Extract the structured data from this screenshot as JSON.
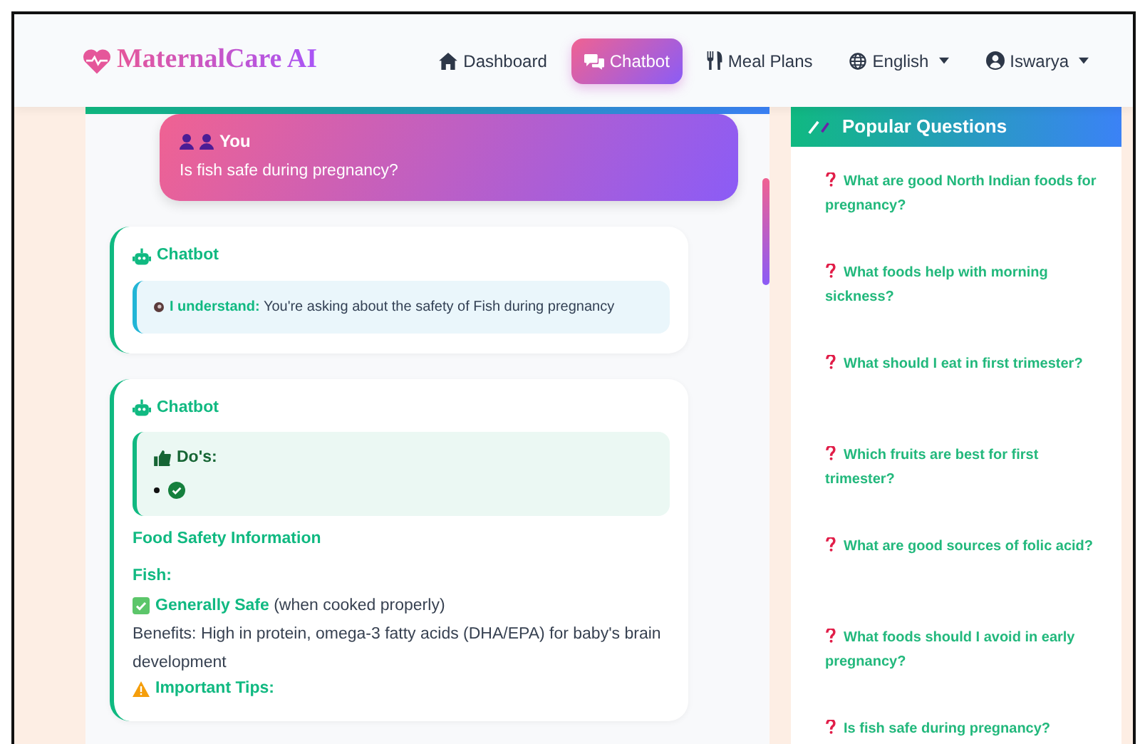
{
  "brand": {
    "name": "MaternalCare AI"
  },
  "nav": [
    {
      "label": "Dashboard",
      "dropdown": false,
      "selected": false
    },
    {
      "label": "Chatbot",
      "dropdown": false,
      "selected": true
    },
    {
      "label": "Meal Plans",
      "dropdown": false,
      "selected": false
    },
    {
      "label": "English",
      "dropdown": true,
      "selected": false
    },
    {
      "label": "Iswarya",
      "dropdown": true,
      "selected": false
    }
  ],
  "messages": [
    {
      "kind": "user",
      "sender": "You",
      "text": "Is fish safe during pregnancy?"
    },
    {
      "kind": "bot",
      "sender": "Chatbot",
      "blocks": [
        {
          "kind": "understand",
          "lead": "I understand:",
          "text": "You're asking about the safety of Fish during pregnancy"
        }
      ]
    },
    {
      "kind": "bot",
      "sender": "Chatbot",
      "blocks": [
        {
          "kind": "dos",
          "title": "Do's:",
          "items": [
            {
              "kind": "check"
            }
          ]
        },
        {
          "kind": "heading",
          "text": "Food Safety Information"
        },
        {
          "kind": "subheading",
          "text": "Fish:"
        },
        {
          "kind": "verdict",
          "label": "Generally Safe",
          "note": "(when cooked properly)"
        },
        {
          "kind": "text",
          "text": "Benefits: High in protein, omega-3 fatty acids (DHA/EPA) for baby's brain development"
        },
        {
          "kind": "warning",
          "text": "Important Tips:"
        }
      ]
    }
  ],
  "popular": {
    "title": "Popular Questions",
    "questions": [
      "What are good North Indian foods for pregnancy?",
      "What foods help with morning sickness?",
      "What should I eat in first trimester?",
      "Which fruits are best for first trimester?",
      "What are good sources of folic acid?",
      "What foods should I avoid in early pregnancy?",
      "Is fish safe during pregnancy?"
    ]
  }
}
